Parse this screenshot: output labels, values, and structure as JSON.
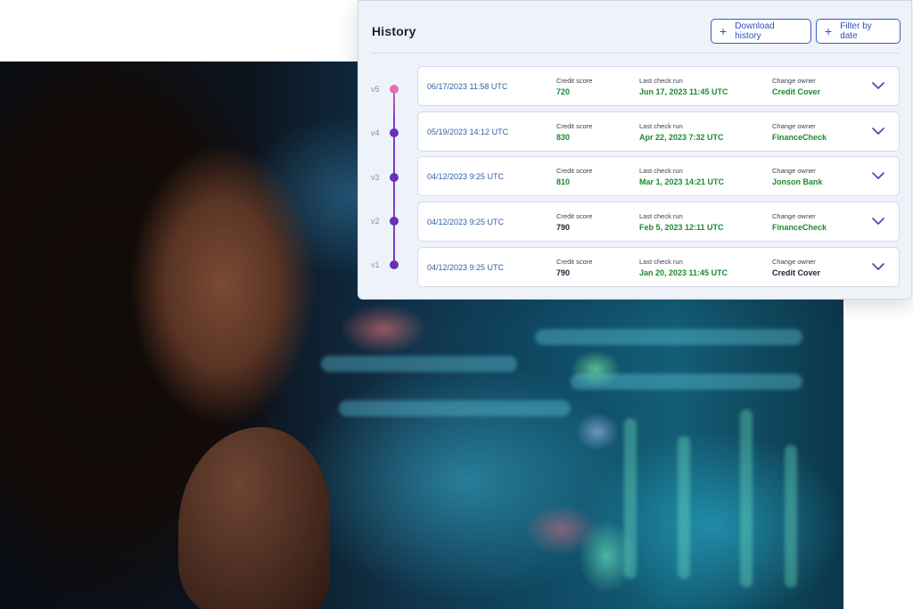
{
  "history": {
    "title": "History",
    "download_label": "Download history",
    "filter_label": "Filter by date",
    "entries": [
      {
        "version": "v5",
        "date": "06/17/2023 11:58 UTC",
        "score_label": "Credit score",
        "score": "720",
        "check_label": "Last check run",
        "check": "Jun 17, 2023 11:45 UTC",
        "owner_label": "Change owner",
        "owner": "Credit Cover"
      },
      {
        "version": "v4",
        "date": "05/19/2023 14:12 UTC",
        "score_label": "Credit score",
        "score": "830",
        "check_label": "Last check run",
        "check": "Apr 22, 2023 7:32 UTC",
        "owner_label": "Change owner",
        "owner": "FinanceCheck"
      },
      {
        "version": "v3",
        "date": "04/12/2023 9:25 UTC",
        "score_label": "Credit score",
        "score": "810",
        "check_label": "Last check run",
        "check": "Mar 1, 2023 14:21 UTC",
        "owner_label": "Change owner",
        "owner": "Jonson Bank"
      },
      {
        "version": "v2",
        "date": "04/12/2023 9:25 UTC",
        "score_label": "Credit score",
        "score": "790",
        "check_label": "Last check run",
        "check": "Feb 5, 2023 12:11 UTC",
        "owner_label": "Change owner",
        "owner": "FinanceCheck"
      },
      {
        "version": "v1",
        "date": "04/12/2023 9:25 UTC",
        "score_label": "Credit score",
        "score": "790",
        "check_label": "Last check run",
        "check": "Jan 20, 2023 11:45 UTC",
        "owner_label": "Change owner",
        "owner": "Credit Cover"
      }
    ]
  },
  "icons": {
    "add": "plus-icon",
    "expand": "chevron-down-icon"
  },
  "colors": {
    "accent_blue": "#3150b8",
    "link_blue": "#2d5fa8",
    "value_green": "#1d8a2f",
    "timeline_purple": "#6c2fb8",
    "timeline_pink": "#e86db8",
    "panel_bg": "#eef2f9"
  }
}
